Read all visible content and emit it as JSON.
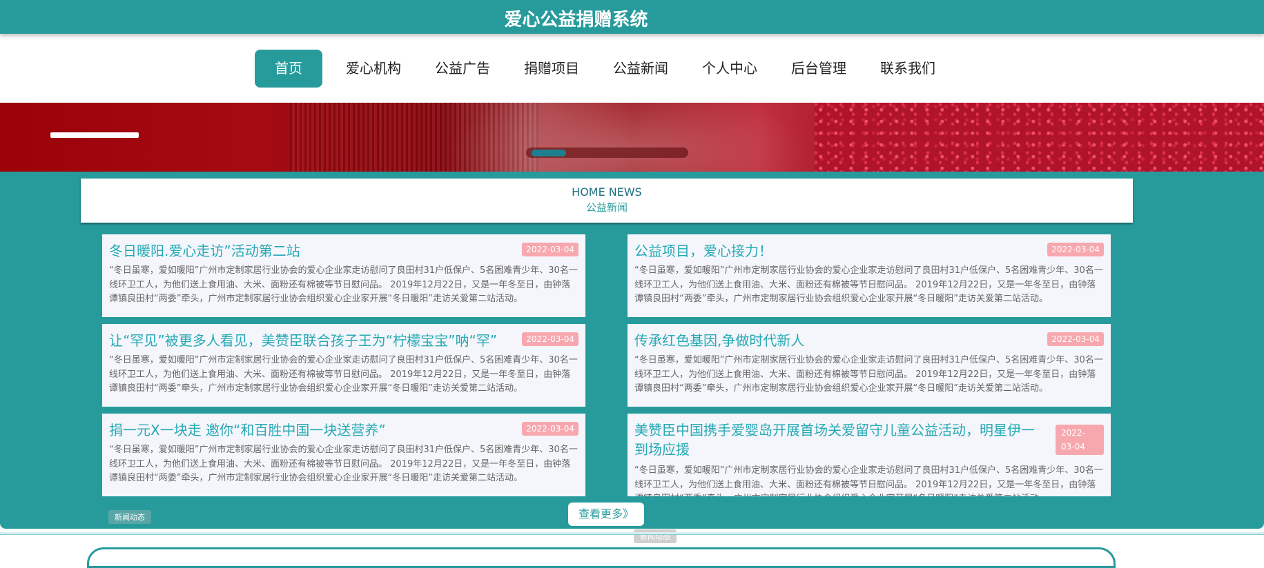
{
  "header": {
    "title": "爱心公益捐赠系统"
  },
  "nav": [
    {
      "label": "首页",
      "active": true
    },
    {
      "label": "爱心机构"
    },
    {
      "label": "公益广告"
    },
    {
      "label": "捐赠项目"
    },
    {
      "label": "公益新闻"
    },
    {
      "label": "个人中心"
    },
    {
      "label": "后台管理"
    },
    {
      "label": "联系我们"
    }
  ],
  "news": {
    "heading_en": "HOME NEWS",
    "heading_cn": "公益新闻",
    "items": [
      {
        "title": "冬日暖阳.爱心走访”活动第二站",
        "date": "2022-03-04",
        "body": "“冬日虽寒，爱如暖阳”广州市定制家居行业协会的爱心企业家走访慰问了良田村31户低保户、5名困难青少年、30名一线环卫工人，为他们送上食用油、大米、面粉还有棉被等节日慰问品。 2019年12月22日，又是一年冬至日，由钟落谭镇良田村“两委”牵头，广州市定制家居行业协会组织爱心企业家开展“冬日暖阳”走访关爱第二站活动。"
      },
      {
        "title": "公益项目，爱心接力！",
        "date": "2022-03-04",
        "body": "“冬日虽寒，爱如暖阳”广州市定制家居行业协会的爱心企业家走访慰问了良田村31户低保户、5名困难青少年、30名一线环卫工人，为他们送上食用油、大米、面粉还有棉被等节日慰问品。 2019年12月22日，又是一年冬至日，由钟落谭镇良田村“两委”牵头，广州市定制家居行业协会组织爱心企业家开展“冬日暖阳”走访关爱第二站活动。"
      },
      {
        "title": "让“罕见”被更多人看见，美赞臣联合孩子王为“柠檬宝宝”呐“罕”",
        "date": "2022-03-04",
        "body": "“冬日虽寒，爱如暖阳”广州市定制家居行业协会的爱心企业家走访慰问了良田村31户低保户、5名困难青少年、30名一线环卫工人，为他们送上食用油、大米、面粉还有棉被等节日慰问品。 2019年12月22日，又是一年冬至日，由钟落谭镇良田村“两委”牵头，广州市定制家居行业协会组织爱心企业家开展“冬日暖阳”走访关爱第二站活动。"
      },
      {
        "title": "传承红色基因,争做时代新人",
        "date": "2022-03-04",
        "body": "“冬日虽寒，爱如暖阳”广州市定制家居行业协会的爱心企业家走访慰问了良田村31户低保户、5名困难青少年、30名一线环卫工人，为他们送上食用油、大米、面粉还有棉被等节日慰问品。 2019年12月22日，又是一年冬至日，由钟落谭镇良田村“两委”牵头，广州市定制家居行业协会组织爱心企业家开展“冬日暖阳”走访关爱第二站活动。"
      },
      {
        "title": "捐一元X一块走 邀你“和百胜中国一块送营养”",
        "date": "2022-03-04",
        "body": "“冬日虽寒，爱如暖阳”广州市定制家居行业协会的爱心企业家走访慰问了良田村31户低保户、5名困难青少年、30名一线环卫工人，为他们送上食用油、大米、面粉还有棉被等节日慰问品。 2019年12月22日，又是一年冬至日，由钟落谭镇良田村“两委”牵头，广州市定制家居行业协会组织爱心企业家开展“冬日暖阳”走访关爱第二站活动。"
      },
      {
        "title": "美赞臣中国携手爱婴岛开展首场关爱留守儿童公益活动，明星伊一到场应援",
        "date": "2022-03-04",
        "body": "“冬日虽寒，爱如暖阳”广州市定制家居行业协会的爱心企业家走访慰问了良田村31户低保户、5名困难青少年、30名一线环卫工人，为他们送上食用油、大米、面粉还有棉被等节日慰问品。 2019年12月22日，又是一年冬至日，由钟落谭镇良田村“两委”牵头，广州市定制家居行业协会组织爱心企业家开展“冬日暖阳”走访关爱第二站活动。"
      }
    ],
    "tag_label": "新闻动态",
    "more_label": "查看更多》"
  }
}
